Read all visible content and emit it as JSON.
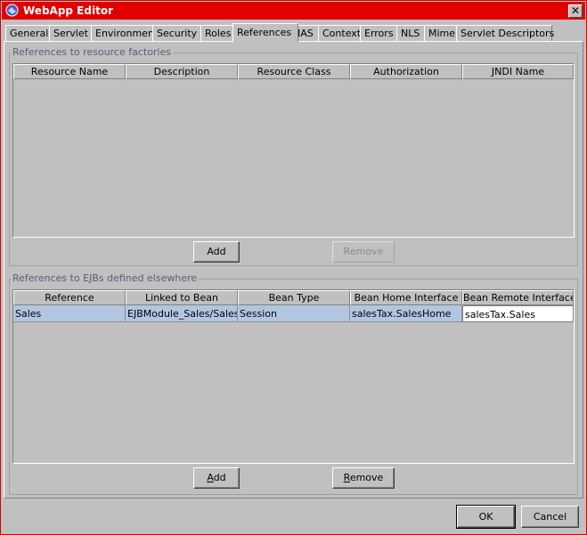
{
  "window": {
    "title": "WebApp Editor",
    "close_glyph": "✕"
  },
  "tabs": [
    {
      "label": "General"
    },
    {
      "label": "Servlet"
    },
    {
      "label": "Environment"
    },
    {
      "label": "Security"
    },
    {
      "label": "Roles"
    },
    {
      "label": "References",
      "active": true
    },
    {
      "label": "IAS"
    },
    {
      "label": "Context"
    },
    {
      "label": "Errors"
    },
    {
      "label": "NLS"
    },
    {
      "label": "Mime"
    },
    {
      "label": "Servlet Descriptors"
    }
  ],
  "resource_factories": {
    "title": "References to resource factories",
    "columns": [
      "Resource Name",
      "Description",
      "Resource Class",
      "Authorization",
      "JNDI Name"
    ],
    "add_label": "Add",
    "remove_label": "Remove"
  },
  "ejb_refs": {
    "title": "References to EJBs defined elsewhere",
    "columns": [
      "Reference",
      "Linked to Bean",
      "Bean Type",
      "Bean Home Interface",
      "Bean Remote Interface"
    ],
    "rows": [
      [
        "Sales",
        "EJBModule_Sales/Sales",
        "Session",
        "salesTax.SalesHome",
        "salesTax.Sales"
      ]
    ],
    "add_label_prefix": "A",
    "add_label_mnemonic": "d",
    "add_label_suffix": "d",
    "remove_label_mnemonic": "R",
    "remove_label_suffix": "emove"
  },
  "footer": {
    "ok_label": "OK",
    "cancel_label": "Cancel"
  },
  "colors": {
    "title_bar": "#e00000",
    "selected_row": "#b2c6e2",
    "window_bg": "#c0c0c0"
  }
}
